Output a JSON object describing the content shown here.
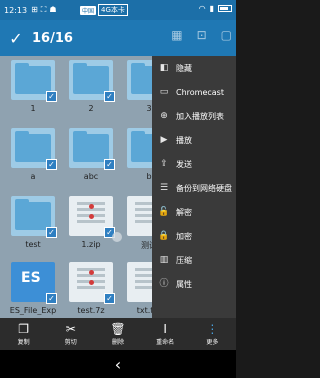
{
  "status": {
    "time": "12:13",
    "carrier_badge": "中国",
    "carrier_text": "4G本卡",
    "icons": [
      "grid-icon",
      "usb-icon",
      "android-icon"
    ],
    "right_icons": [
      "wifi-icon",
      "signal-icon",
      "battery-icon"
    ]
  },
  "toolbar": {
    "count": "16/16"
  },
  "files": [
    {
      "name": "1",
      "kind": "folder"
    },
    {
      "name": "2",
      "kind": "folder"
    },
    {
      "name": "3",
      "kind": "folder"
    },
    {
      "name": "a",
      "kind": "folder"
    },
    {
      "name": "abc",
      "kind": "folder"
    },
    {
      "name": "b",
      "kind": "folder"
    },
    {
      "name": "test",
      "kind": "folder"
    },
    {
      "name": "1.zip",
      "kind": "file"
    },
    {
      "name": "测试",
      "kind": "file"
    },
    {
      "name": "ES_File_Exp",
      "kind": "apk"
    },
    {
      "name": "test.7z",
      "kind": "file"
    },
    {
      "name": "txt.txt",
      "kind": "file"
    }
  ],
  "menu": {
    "items": [
      {
        "label": "隐藏",
        "icon": "hide-icon"
      },
      {
        "label": "Chromecast",
        "icon": "cast-icon"
      },
      {
        "label": "加入播放列表",
        "icon": "playlist-add-icon"
      },
      {
        "label": "播放",
        "icon": "play-icon"
      },
      {
        "label": "发送",
        "icon": "send-icon"
      },
      {
        "label": "备份到网络硬盘",
        "icon": "cloud-backup-icon"
      },
      {
        "label": "解密",
        "icon": "decrypt-icon"
      },
      {
        "label": "加密",
        "icon": "encrypt-icon"
      },
      {
        "label": "压缩",
        "icon": "compress-icon"
      },
      {
        "label": "属性",
        "icon": "properties-icon"
      }
    ]
  },
  "bottom": {
    "copy": "复制",
    "cut": "剪切",
    "delete": "删除",
    "rename": "重命名",
    "more": "更多"
  }
}
